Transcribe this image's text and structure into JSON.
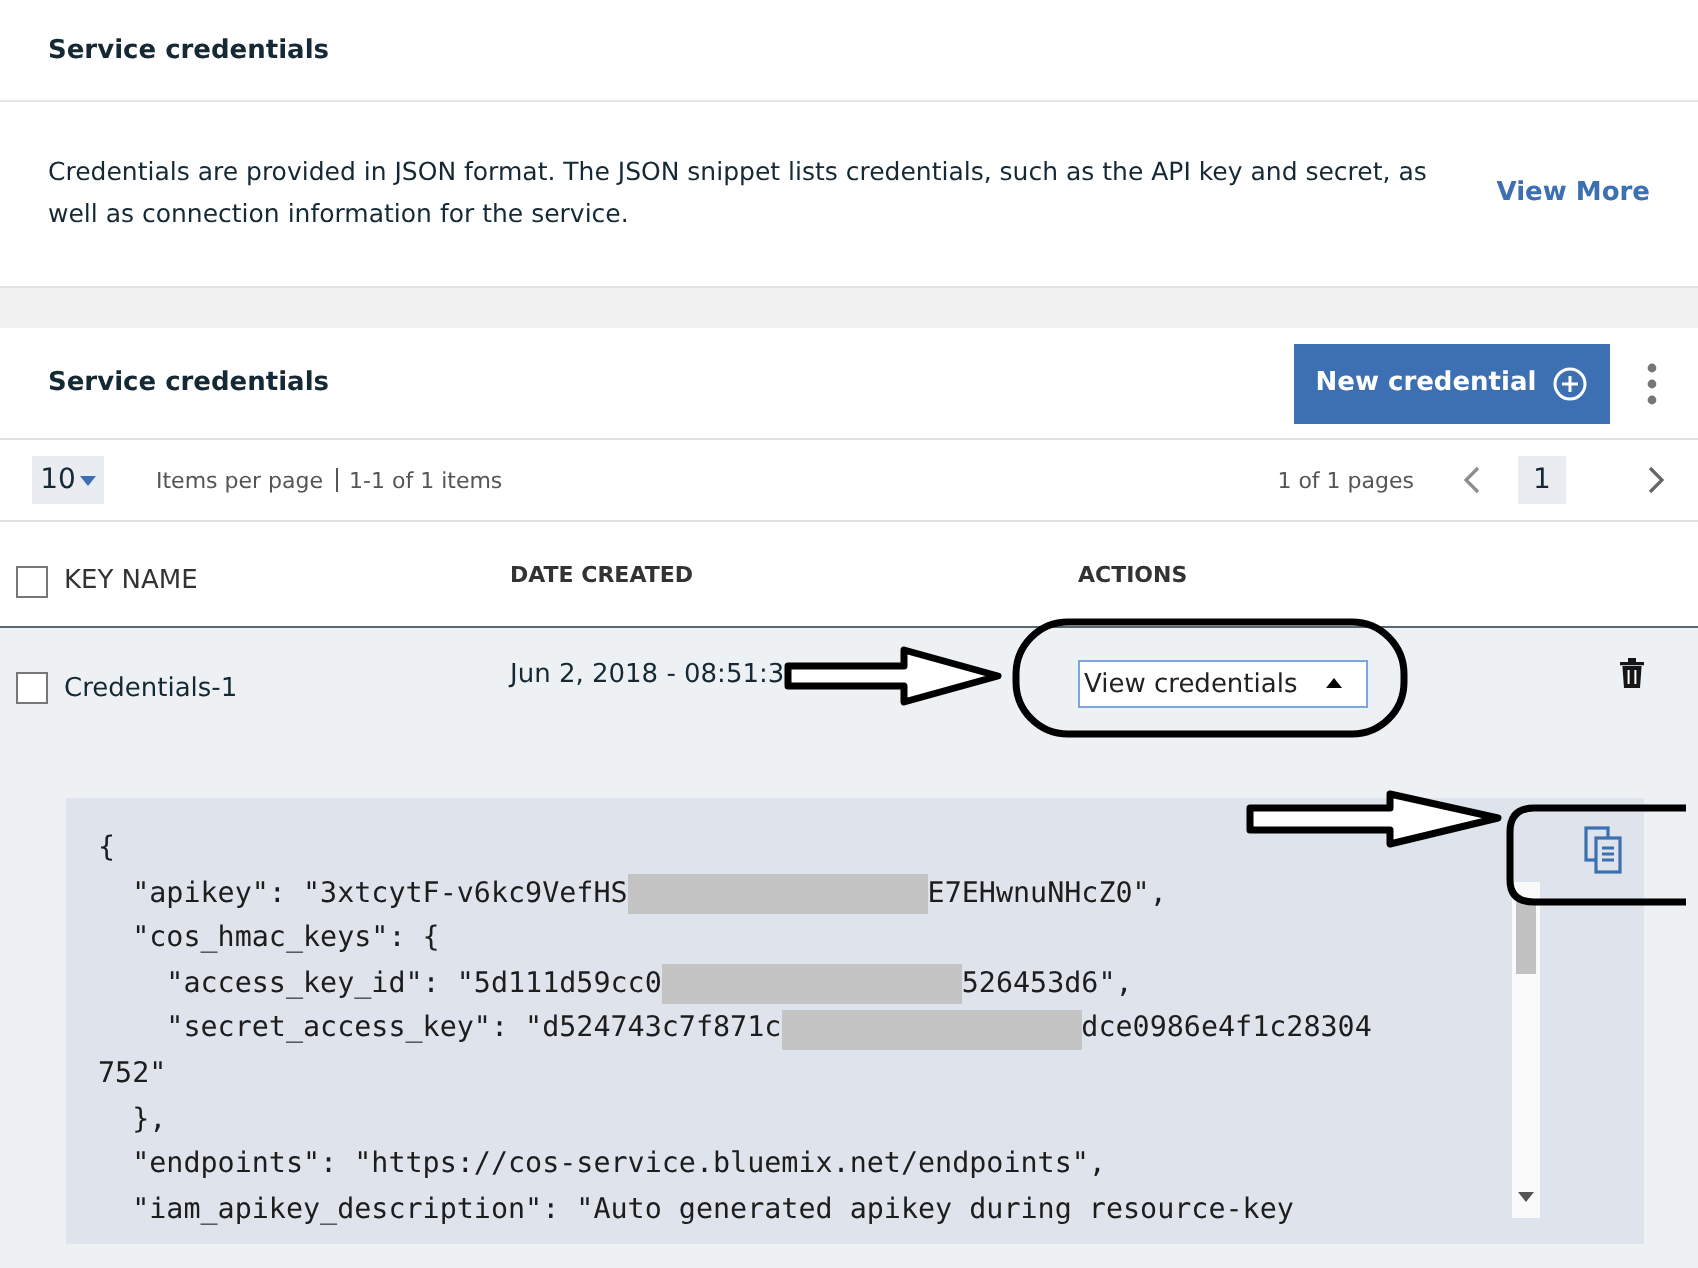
{
  "info_card": {
    "title": "Service credentials",
    "description": "Credentials are provided in JSON format. The JSON snippet lists credentials, such as the API key and secret, as well as connection information for the service.",
    "link": "View More"
  },
  "table_section": {
    "title": "Service credentials",
    "new_button": "New credential",
    "pagination": {
      "page_size": "10",
      "items_per_page": "Items per page",
      "range": "1-1 of 1 items",
      "pages": "1 of 1 pages",
      "current_page": "1"
    },
    "columns": [
      {
        "label": "KEY NAME",
        "kind": "checkbox",
        "checked": false
      },
      {
        "label": "DATE CREATED",
        "kind": "text"
      },
      {
        "label": "ACTIONS",
        "kind": "text"
      }
    ],
    "rows": [
      {
        "checked": false,
        "expanded": true,
        "key_name": "Credentials-1",
        "date_created": "Jun 2, 2018 - 08:51:3",
        "action": "View credentials"
      }
    ],
    "code_lines": [
      [
        {
          "kind": "text",
          "text": "{"
        }
      ],
      [
        {
          "kind": "text",
          "text": "  \"apikey\": \"3xtcytF-v6kc9VefHS"
        },
        {
          "kind": "redacted"
        },
        {
          "kind": "text",
          "text": "E7EHwnuNHcZ0\","
        }
      ],
      [
        {
          "kind": "text",
          "text": "  \"cos_hmac_keys\": {"
        }
      ],
      [
        {
          "kind": "text",
          "text": "    \"access_key_id\": \"5d111d59cc0"
        },
        {
          "kind": "redacted"
        },
        {
          "kind": "text",
          "text": "526453d6\","
        }
      ],
      [
        {
          "kind": "text",
          "text": "    \"secret_access_key\": \"d524743c7f871c"
        },
        {
          "kind": "redacted"
        },
        {
          "kind": "text",
          "text": "dce0986e4f1c28304"
        }
      ],
      [
        {
          "kind": "text",
          "text": "752\""
        }
      ],
      [
        {
          "kind": "text",
          "text": "  },"
        }
      ],
      [
        {
          "kind": "text",
          "text": "  \"endpoints\": \"https://cos-service.bluemix.net/endpoints\","
        }
      ],
      [
        {
          "kind": "text",
          "text": "  \"iam_apikey_description\": \"Auto generated apikey during resource-key"
        }
      ]
    ]
  }
}
